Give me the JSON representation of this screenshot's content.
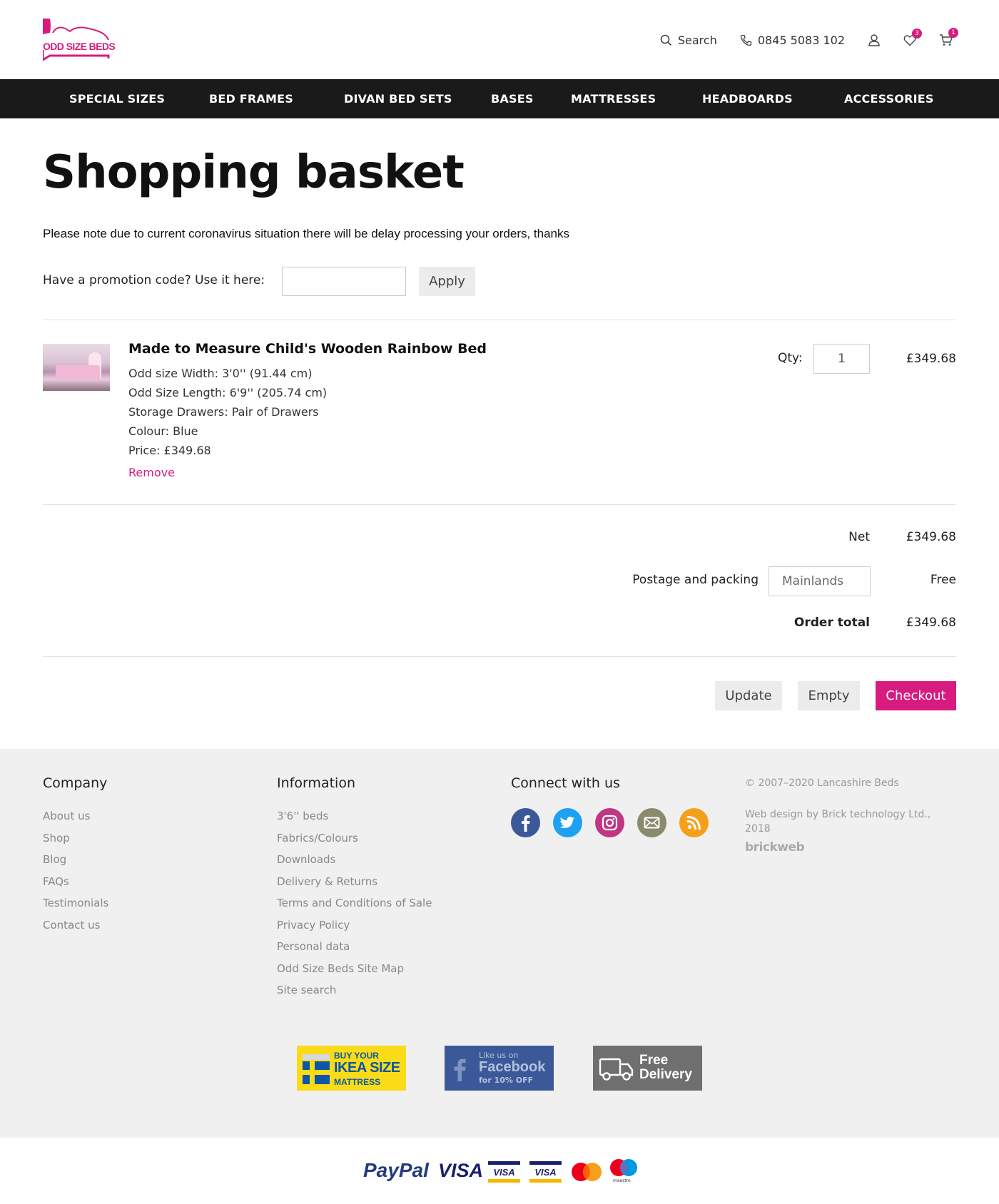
{
  "header": {
    "logo_text": "ODD SIZE BEDS",
    "search_label": "Search",
    "phone": "0845 5083 102",
    "wishlist_count": "3",
    "cart_count": "1"
  },
  "nav": [
    "SPECIAL SIZES",
    "BED FRAMES",
    "DIVAN BED SETS",
    "BASES",
    "MATTRESSES",
    "HEADBOARDS",
    "ACCESSORIES"
  ],
  "page": {
    "title": "Shopping basket",
    "notice": "Please note due to current coronavirus situation there will be delay processing your orders, thanks",
    "promo_label": "Have a promotion code? Use it here:",
    "apply_label": "Apply"
  },
  "item": {
    "name": "Made to Measure Child's Wooden Rainbow Bed",
    "options": [
      "Odd size Width: 3'0'' (91.44 cm)",
      "Odd Size Length: 6'9'' (205.74 cm)",
      "Storage Drawers: Pair of Drawers",
      "Colour: Blue",
      "Price: £349.68"
    ],
    "remove_label": "Remove",
    "qty_label": "Qty:",
    "qty": "1",
    "line_total": "£349.68"
  },
  "totals": {
    "net_label": "Net",
    "net": "£349.68",
    "postage_label": "Postage and packing",
    "postage_option": "Mainlands",
    "postage": "Free",
    "total_label": "Order total",
    "total": "£349.68"
  },
  "actions": {
    "update": "Update",
    "empty": "Empty",
    "checkout": "Checkout"
  },
  "footer": {
    "company_heading": "Company",
    "company_links": [
      "About us",
      "Shop",
      "Blog",
      "FAQs",
      "Testimonials",
      "Contact us"
    ],
    "info_heading": "Information",
    "info_links": [
      "3'6'' beds",
      "Fabrics/Colours",
      "Downloads",
      "Delivery & Returns",
      "Terms and Conditions of Sale",
      "Privacy Policy",
      "Personal data",
      "Odd Size Beds Site Map",
      "Site search"
    ],
    "connect_heading": "Connect with us",
    "social": [
      {
        "name": "facebook-icon",
        "color": "#3b5998"
      },
      {
        "name": "twitter-icon",
        "color": "#1da1f2"
      },
      {
        "name": "instagram-icon",
        "color": "#c13584"
      },
      {
        "name": "email-icon",
        "color": "#8a8a6e"
      },
      {
        "name": "rss-icon",
        "color": "#f5a01a"
      }
    ],
    "copyright": "© 2007–2020  Lancashire Beds",
    "credit": "Web design by Brick technology Ltd., 2018",
    "brickweb": "brickweb",
    "banners": {
      "ikea": {
        "line1": "BUY YOUR",
        "line2": "IKEA SIZE",
        "line3": "MATTRESS"
      },
      "facebook": {
        "line1": "Like us on",
        "line2": "Facebook",
        "line3": "for 10% OFF"
      },
      "delivery": {
        "line1": "Free",
        "line2": "Delivery"
      }
    }
  },
  "payments": {
    "paypal": "PayPal",
    "visa": "VISA",
    "visa_small": "VISA",
    "maestro": "maestro"
  },
  "colors": {
    "brand_pink": "#d81b7f",
    "nav_bg": "#1a1a1a",
    "footer_bg": "#f0f0f0"
  }
}
